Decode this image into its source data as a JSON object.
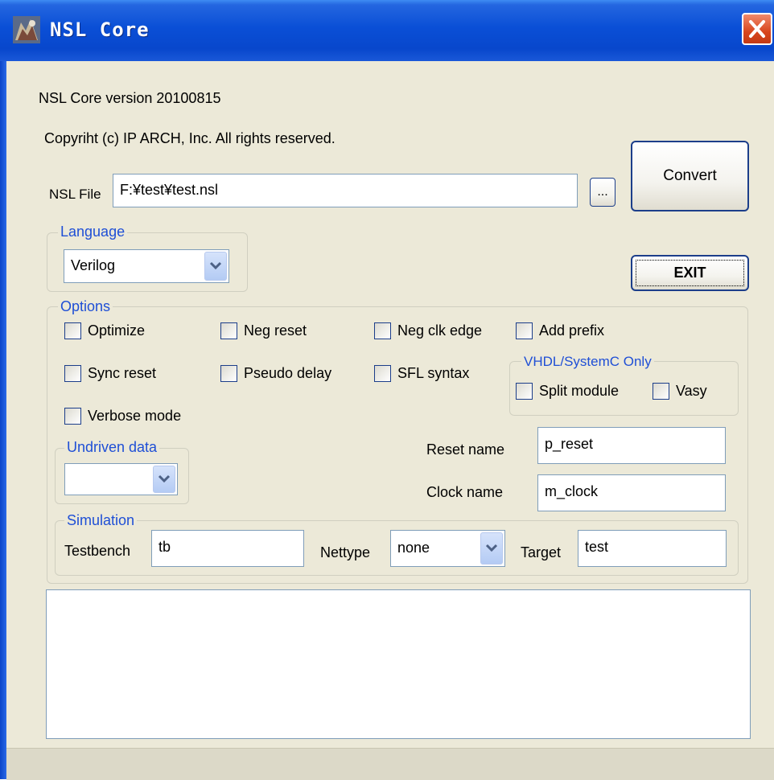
{
  "window": {
    "title": "NSL Core"
  },
  "header": {
    "version": "NSL Core version 20100815",
    "copyright": "Copyriht (c)  IP ARCH, Inc. All rights reserved."
  },
  "file": {
    "label": "NSL File",
    "value": "F:¥test¥test.nsl",
    "browse_label": "..."
  },
  "buttons": {
    "convert": "Convert",
    "exit": "EXIT"
  },
  "language": {
    "title": "Language",
    "selected": "Verilog"
  },
  "options": {
    "title": "Options",
    "optimize": "Optimize",
    "neg_reset": "Neg reset",
    "neg_clk_edge": "Neg clk edge",
    "add_prefix": "Add prefix",
    "sync_reset": "Sync reset",
    "pseudo_delay": "Pseudo delay",
    "sfl_syntax": "SFL syntax",
    "verbose_mode": "Verbose mode"
  },
  "vhdl": {
    "title": "VHDL/SystemC Only",
    "split_module": "Split module",
    "vasy": "Vasy"
  },
  "undriven": {
    "title": "Undriven data",
    "selected": ""
  },
  "names": {
    "reset_label": "Reset name",
    "reset_value": "p_reset",
    "clock_label": "Clock name",
    "clock_value": "m_clock"
  },
  "simulation": {
    "title": "Simulation",
    "testbench_label": "Testbench",
    "testbench_value": "tb",
    "nettype_label": "Nettype",
    "nettype_value": "none",
    "target_label": "Target",
    "target_value": "test"
  },
  "log": {
    "text": ""
  }
}
